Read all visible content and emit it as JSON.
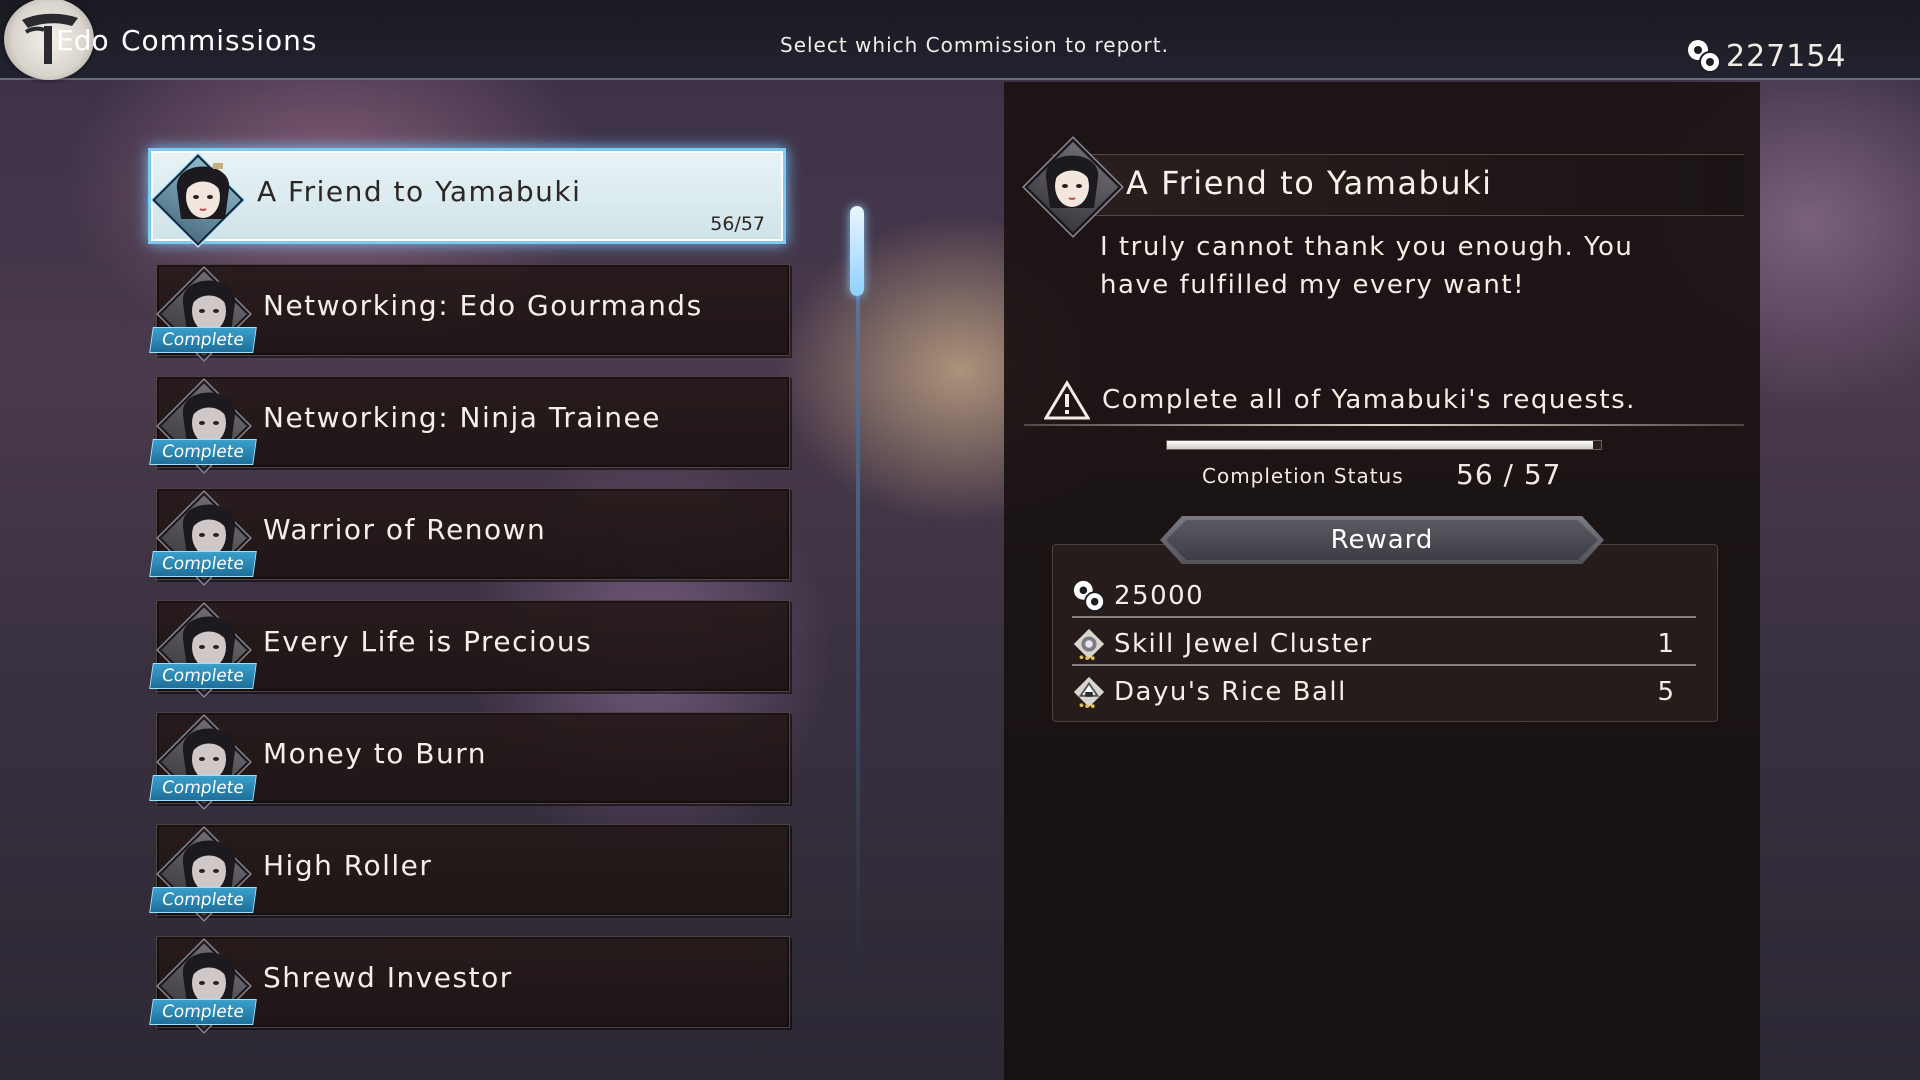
{
  "header": {
    "region": "Edo",
    "title": "Commissions",
    "instruction": "Select which Commission to report.",
    "money": "227154",
    "money_icon": "coin-icon"
  },
  "commissions": [
    {
      "name": "A Friend to Yamabuki",
      "progress": "56/57",
      "status": "",
      "selected": true
    },
    {
      "name": "Networking: Edo Gourmands",
      "status": "Complete"
    },
    {
      "name": "Networking: Ninja Trainee",
      "status": "Complete"
    },
    {
      "name": "Warrior of Renown",
      "status": "Complete"
    },
    {
      "name": "Every Life is Precious",
      "status": "Complete"
    },
    {
      "name": "Money to Burn",
      "status": "Complete"
    },
    {
      "name": "High Roller",
      "status": "Complete"
    },
    {
      "name": "Shrewd Investor",
      "status": "Complete"
    }
  ],
  "detail": {
    "title": "A Friend to Yamabuki",
    "description": "I truly cannot thank you enough. You have fulfilled my every want!",
    "objective": "Complete all of Yamabuki's requests.",
    "objective_icon": "warning-icon",
    "completion_label": "Completion Status",
    "completion_value": "56 / 57",
    "completion_fraction": 0.982,
    "reward_label": "Reward",
    "rewards": [
      {
        "name": "25000",
        "qty": "",
        "icon": "coin-icon"
      },
      {
        "name": "Skill Jewel Cluster",
        "qty": "1",
        "icon": "jewel-icon"
      },
      {
        "name": "Dayu's Rice Ball",
        "qty": "5",
        "icon": "rice-ball-icon"
      }
    ]
  },
  "colors": {
    "accent": "#7fc8ee",
    "badge": "#2a8bbd",
    "panel": "#1e1616"
  }
}
